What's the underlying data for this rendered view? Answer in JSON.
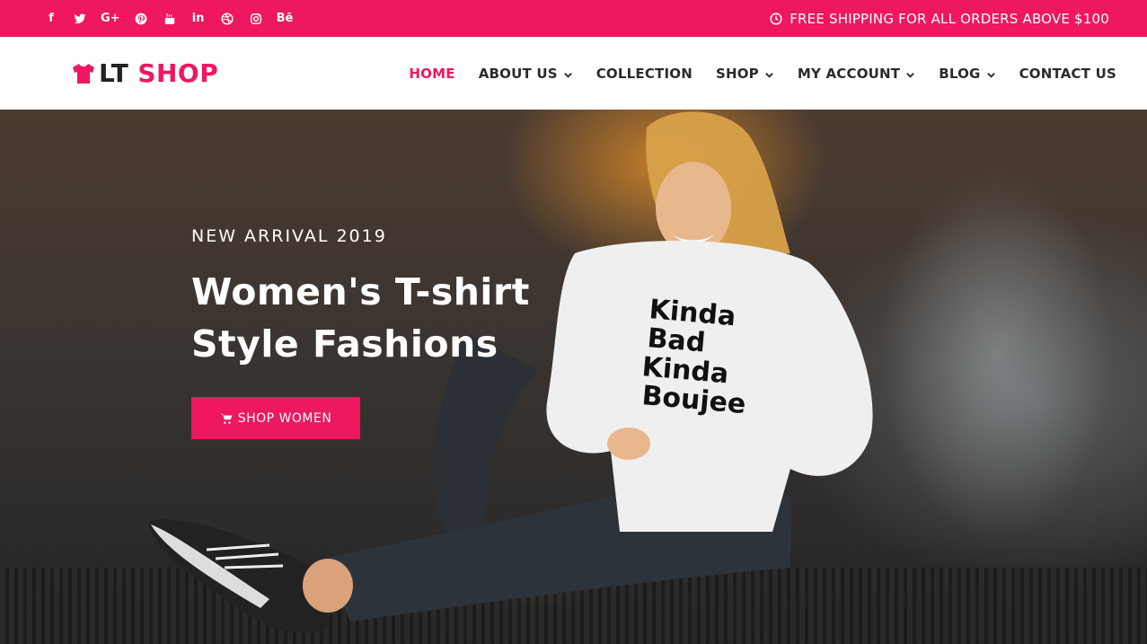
{
  "topbar": {
    "social_icons": [
      "facebook-icon",
      "twitter-icon",
      "google-plus-icon",
      "pinterest-icon",
      "youtube-icon",
      "linkedin-icon",
      "dribbble-icon",
      "instagram-icon",
      "behance-icon"
    ],
    "shipping_text": "FREE SHIPPING FOR ALL ORDERS ABOVE $100",
    "accent_color": "#ee1760"
  },
  "header": {
    "logo_lt": "LT",
    "logo_shop": "SHOP",
    "nav": [
      {
        "label": "HOME",
        "active": true,
        "dropdown": false
      },
      {
        "label": "ABOUT US",
        "active": false,
        "dropdown": true
      },
      {
        "label": "COLLECTION",
        "active": false,
        "dropdown": false
      },
      {
        "label": "SHOP",
        "active": false,
        "dropdown": true
      },
      {
        "label": "MY ACCOUNT",
        "active": false,
        "dropdown": true
      },
      {
        "label": "BLOG",
        "active": false,
        "dropdown": true
      },
      {
        "label": "CONTACT US",
        "active": false,
        "dropdown": false
      }
    ]
  },
  "hero": {
    "subtitle": "NEW ARRIVAL 2019",
    "title": "Women's T-shirt Style Fashions",
    "cta_label": "SHOP WOMEN",
    "shirt_text": [
      "Kinda",
      "Bad",
      "Kinda",
      "Boujee"
    ]
  }
}
